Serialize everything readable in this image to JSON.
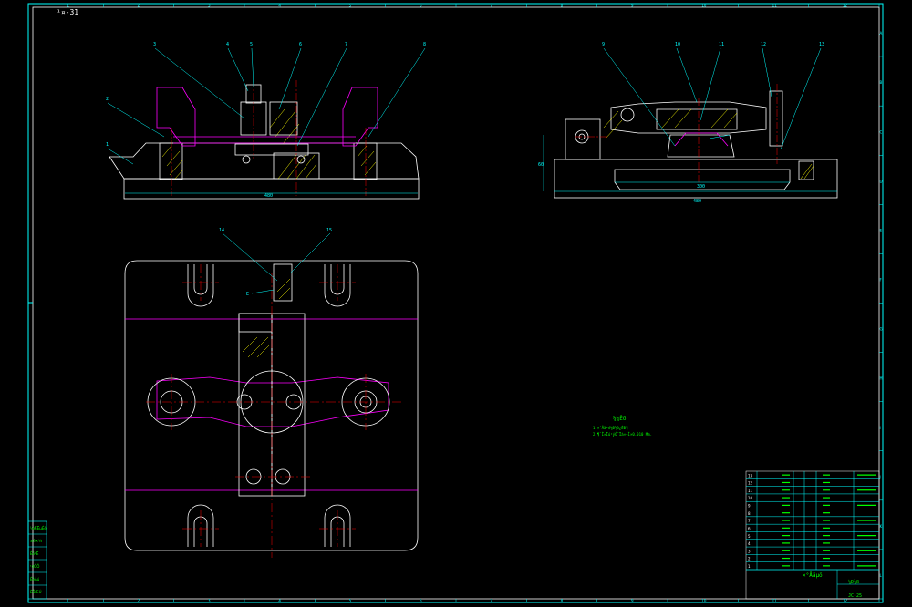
{
  "sheet": {
    "tag": "¹¤-31",
    "border_color": "#ffffff",
    "frame_color": "#00ffff",
    "top_ruler": [
      "1",
      "2",
      "3",
      "4",
      "5",
      "6",
      "7",
      "8",
      "9",
      "10",
      "11",
      "12"
    ],
    "side_ruler": [
      "A",
      "B",
      "C",
      "D",
      "E",
      "F",
      "G",
      "H",
      "I",
      "J",
      "K",
      "L"
    ]
  },
  "colors": {
    "outline": "#ffffff",
    "center_line": "#ff0000",
    "hidden_line": "#ff00ff",
    "leader": "#00ffff",
    "hatch": "#ffff00",
    "text": "#00ff00"
  },
  "front_view": {
    "balloons": [
      "3",
      "4",
      "5",
      "6",
      "7",
      "8",
      "2",
      "1"
    ],
    "dimension": "480"
  },
  "side_view": {
    "balloons": [
      "9",
      "10",
      "11",
      "12",
      "13"
    ],
    "dimensions": [
      "300",
      "480",
      "60"
    ]
  },
  "top_view": {
    "balloons": [
      "14",
      "15",
      "E"
    ]
  },
  "notes": {
    "title": "¼¼Êõ",
    "lines": [
      "1.×°Åäºó¼Ð½ô¿ÉÐ¶",
      "2.¶¨Î»Ïú¹ýÓ¯Ïà×÷Ì×0.010 Mm."
    ]
  },
  "title_block": {
    "rows": [
      "13",
      "12",
      "11",
      "10",
      "9",
      "8",
      "7",
      "6",
      "5",
      "4",
      "3",
      "2",
      "1"
    ],
    "drawing_title": "×°Åäµö",
    "name": "¼Ð¾ß",
    "code": "JC-25",
    "side_stamps": [
      "¼ÆËµÉè",
      "±ê×¼",
      "ÉóºË",
      "¹¤ÒÕ",
      "ÉèÅú",
      "ÈÕÆÚ"
    ]
  }
}
